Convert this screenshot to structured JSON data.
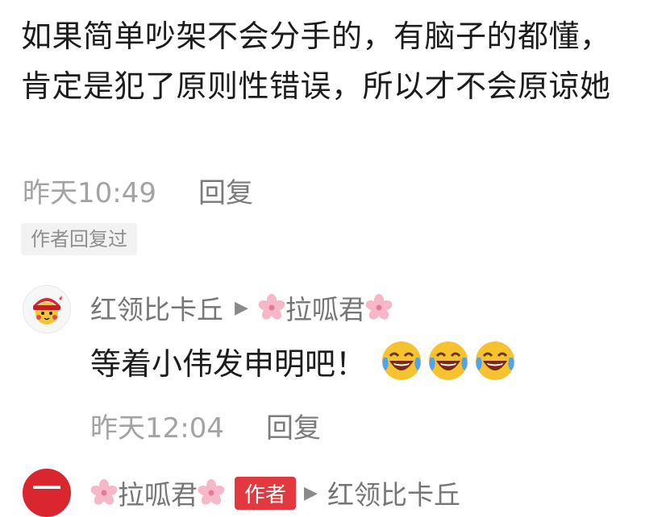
{
  "comment": {
    "text": "如果简单吵架不会分手的，有脑子的都懂，肯定是犯了原则性错误，所以才不会原谅她",
    "time": "昨天10:49",
    "reply_label": "回复",
    "author_replied_tag": "作者回复过"
  },
  "reply1": {
    "user": "红领比卡丘",
    "arrow": "▶",
    "target_user": "拉呱君",
    "text": "等着小伟发申明吧！",
    "emojis": [
      "tears-of-joy-icon",
      "tears-of-joy-icon",
      "tears-of-joy-icon"
    ],
    "time": "昨天12:04",
    "reply_label": "回复"
  },
  "reply2": {
    "user": "拉呱君",
    "author_badge": "作者",
    "arrow": "▶",
    "target_user": "红领比卡丘"
  },
  "colors": {
    "text": "#1c1c1c",
    "muted": "#a3a3a3",
    "accent_red": "#e2383f",
    "tag_bg": "#f2f2f2"
  }
}
